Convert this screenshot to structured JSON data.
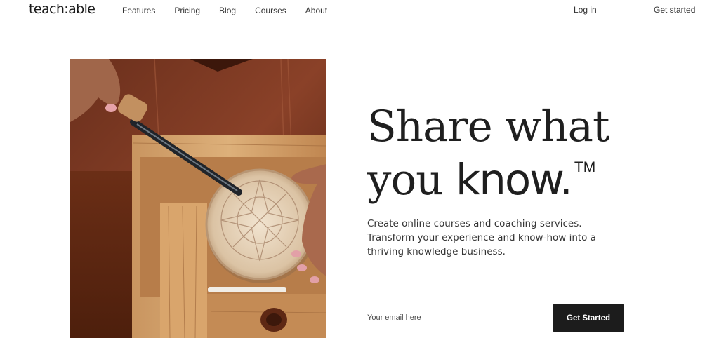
{
  "header": {
    "logo": "teach:able",
    "nav": [
      "Features",
      "Pricing",
      "Blog",
      "Courses",
      "About"
    ],
    "login_label": "Log in",
    "get_started_label": "Get started"
  },
  "hero": {
    "headline_line1": "Share what",
    "headline_line2_prefix": "you ",
    "headline_line2_strong": "know.",
    "trademark": "TM",
    "subtext": "Create online courses and coaching services. Transform your experience and know-how into a thriving knowledge business.",
    "email_placeholder": "Your email here",
    "cta_label": "Get Started"
  }
}
